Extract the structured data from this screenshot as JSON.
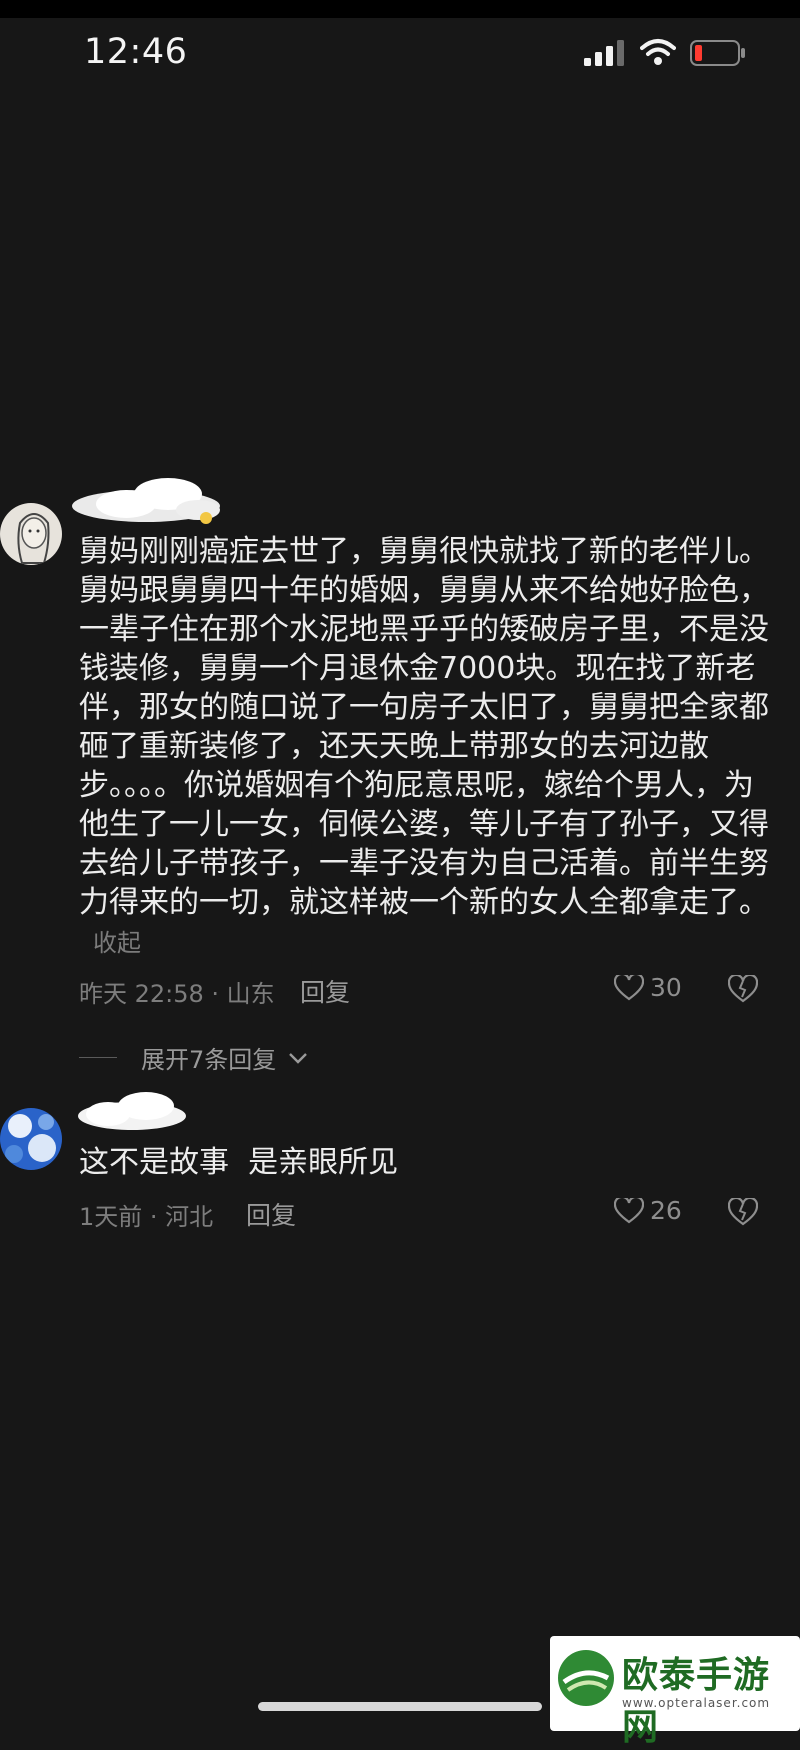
{
  "status_bar": {
    "time": "12:46"
  },
  "comments": [
    {
      "body": "舅妈刚刚癌症去世了，舅舅很快就找了新的老伴儿。舅妈跟舅舅四十年的婚姻，舅舅从来不给她好脸色，一辈子住在那个水泥地黑乎乎的矮破房子里，不是没钱装修，舅舅一个月退休金7000块。现在找了新老伴，那女的随口说了一句房子太旧了，舅舅把全家都砸了重新装修了，还天天晚上带那女的去河边散步。。。。你说婚姻有个狗屁意思呢，嫁给个男人，为他生了一儿一女，伺候公婆，等儿子有了孙子，又得去给儿子带孩子，一辈子没有为自己活着。前半生努力得来的一切，就这样被一个新的女人全都拿走了。",
      "collapse_label": "收起",
      "meta": "昨天 22:58 · 山东",
      "reply_label": "回复",
      "likes": "30",
      "expand_label": "展开7条回复"
    },
    {
      "body": "这不是故事  是亲眼所见",
      "meta": "1天前 · 河北",
      "reply_label": "回复",
      "likes": "26"
    }
  ],
  "watermark": {
    "title": "欧泰手游网",
    "url": "www.opteralaser.com"
  },
  "colors": {
    "background": "#171717",
    "text": "#ececec",
    "meta": "#7d7d7d",
    "watermark_green": "#1f6b23"
  }
}
